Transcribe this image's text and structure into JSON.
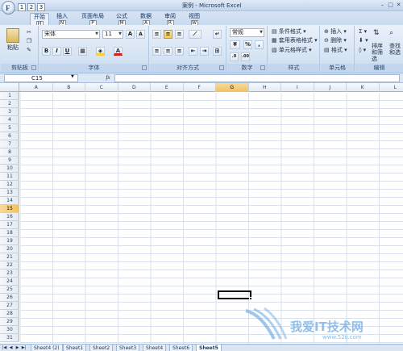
{
  "window": {
    "title": "案例 - Microsoft Excel",
    "office_button_glyph": "F",
    "qat_keys": [
      "1",
      "2",
      "3"
    ],
    "controls": [
      "–",
      "□",
      "✕"
    ]
  },
  "tabs": [
    {
      "label": "开始",
      "key": "H"
    },
    {
      "label": "插入",
      "key": "N"
    },
    {
      "label": "页面布局",
      "key": "P"
    },
    {
      "label": "公式",
      "key": "M"
    },
    {
      "label": "数据",
      "key": "A"
    },
    {
      "label": "审阅",
      "key": "R"
    },
    {
      "label": "视图",
      "key": "W"
    }
  ],
  "ribbon": {
    "clipboard": {
      "label": "剪贴板",
      "paste": "粘贴"
    },
    "font": {
      "label": "字体",
      "name": "宋体",
      "size": "11"
    },
    "alignment": {
      "label": "对齐方式"
    },
    "number": {
      "label": "数字",
      "format": "常规"
    },
    "styles": {
      "label": "样式",
      "items": [
        "条件格式",
        "套用表格格式",
        "单元格样式"
      ]
    },
    "cells": {
      "label": "单元格",
      "items": [
        "插入",
        "删除",
        "格式"
      ]
    },
    "editing": {
      "label": "编辑",
      "items": [
        "排序和筛选",
        "查找和选择"
      ]
    }
  },
  "formula_bar": {
    "name_box": "C15",
    "fx": "fx",
    "value": ""
  },
  "grid": {
    "columns": [
      "A",
      "B",
      "C",
      "D",
      "E",
      "F",
      "G",
      "H",
      "I",
      "J",
      "K",
      "L"
    ],
    "rows": [
      "1",
      "2",
      "3",
      "4",
      "5",
      "6",
      "7",
      "8",
      "9",
      "10",
      "11",
      "12",
      "13",
      "14",
      "15",
      "16",
      "17",
      "18",
      "19",
      "20",
      "21",
      "22",
      "23",
      "24",
      "25",
      "26",
      "27",
      "28",
      "29",
      "30",
      "31"
    ],
    "selected_column": "G",
    "selected_row": "15"
  },
  "sheets": [
    "Sheet4 (2)",
    "Sheet1",
    "Sheet2",
    "Sheet3",
    "Sheet4",
    "Sheet6",
    "Sheet5"
  ],
  "active_sheet": "Sheet5",
  "watermark": {
    "text": "我爱IT技术网",
    "url": "www.52ij.com"
  }
}
